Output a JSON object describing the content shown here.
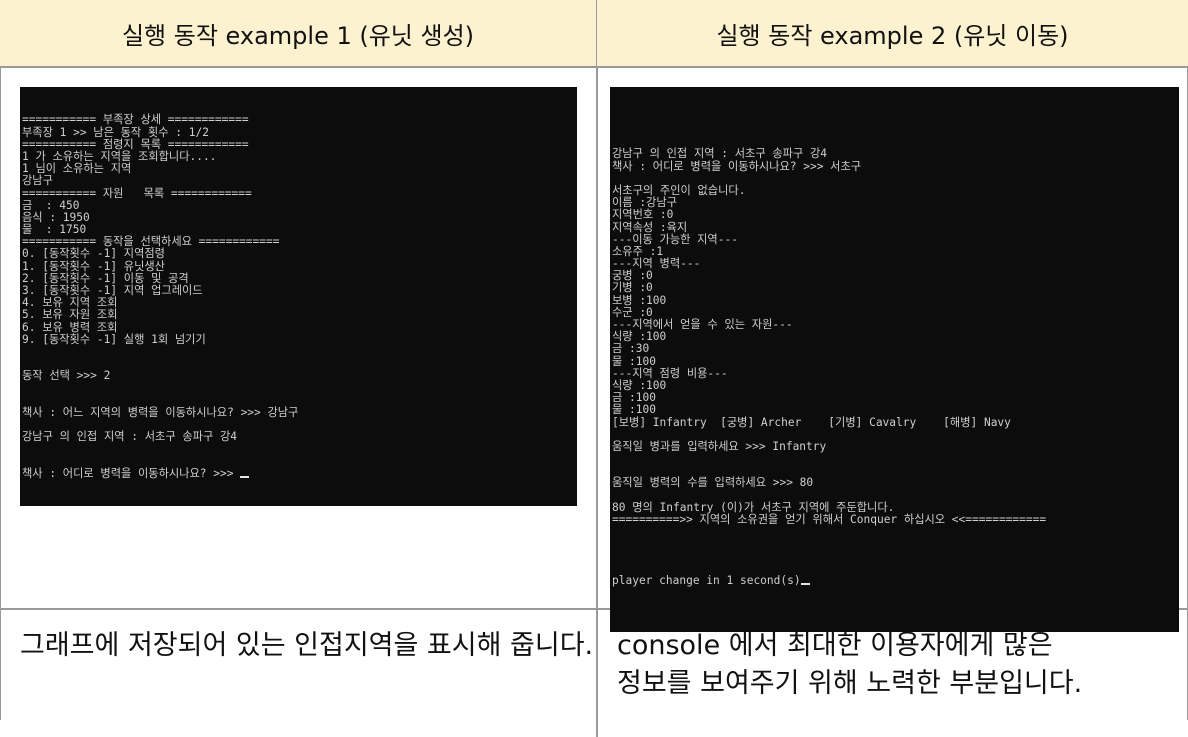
{
  "headers": {
    "left": "실행 동작 example 1 (유닛 생성)",
    "right": "실행 동작 example 2 (유닛 이동)"
  },
  "console_left": {
    "lines": [
      "=========== 부족장 상세 ============",
      "부족장 1 >> 남은 동작 횟수 : 1/2",
      "=========== 점령지 목록 ============",
      "1 가 소유하는 지역을 조회합니다....",
      "1 님이 소유하는 지역",
      "강남구",
      "=========== 자원   목록 ============",
      "금  : 450",
      "음식 : 1950",
      "물  : 1750",
      "=========== 동작을 선택하세요 ============",
      "0. [동작횟수 -1] 지역점령",
      "1. [동작횟수 -1] 유닛생산",
      "2. [동작횟수 -1] 이동 및 공격",
      "3. [동작횟수 -1] 지역 업그레이드",
      "4. 보유 지역 조회",
      "5. 보유 자원 조회",
      "6. 보유 병력 조회",
      "9. [동작횟수 -1] 실행 1회 넘기기",
      "",
      "",
      "동작 선택 >>> 2",
      "",
      "",
      "책사 : 어느 지역의 병력을 이동하시나요? >>> 강남구",
      "",
      "강남구 의 인접 지역 : 서초구 송파구 강4"
    ],
    "prompt_line": "책사 : 어디로 병력을 이동하시나요? >>> "
  },
  "console_right": {
    "lines": [
      "강남구 의 인접 지역 : 서초구 송파구 강4",
      "책사 : 어디로 병력을 이동하시나요? >>> 서초구",
      "",
      "서초구의 주인이 없습니다.",
      "이름 :강남구",
      "지역번호 :0",
      "지역속성 :육지",
      "---이동 가능한 지역---",
      "소유주 :1",
      "---지역 병력---",
      "궁병 :0",
      "기병 :0",
      "보병 :100",
      "수군 :0",
      "---지역에서 얻을 수 있는 자원---",
      "식량 :100",
      "금 :30",
      "물 :100",
      "---지역 점령 비용---",
      "식량 :100",
      "금 :100",
      "물 :100",
      "[보병] Infantry  [궁병] Archer    [기병] Cavalry    [해병] Navy",
      "",
      "움직일 병과를 입력하세요 >>> Infantry",
      "",
      "",
      "움직일 병력의 수를 입력하세요 >>> 80",
      "",
      "80 명의 Infantry (이)가 서초구 지역에 주둔합니다.",
      "==========>> 지역의 소유권을 얻기 위해서 Conquer 하십시오 <<============",
      "",
      ""
    ],
    "prompt_line": "player change in 1 second(s)"
  },
  "footer": {
    "left": "그래프에 저장되어 있는 인접지역을 표시해 줍니다.",
    "right_line1": "console 에서 최대한 이용자에게 많은",
    "right_line2": "정보를 보여주기 위해 노력한 부분입니다."
  }
}
